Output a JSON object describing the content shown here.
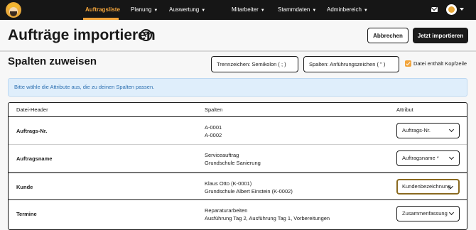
{
  "nav": {
    "items": [
      {
        "label": "Auftragsliste",
        "caret": ""
      },
      {
        "label": "Planung",
        "caret": "▼"
      },
      {
        "label": "Auswertung",
        "caret": "▼"
      },
      {
        "label": "Mitarbeiter",
        "caret": "▼"
      },
      {
        "label": "Stammdaten",
        "caret": "▼"
      },
      {
        "label": "Adminbereich",
        "caret": "▼"
      }
    ],
    "active_color": "#f2a43b"
  },
  "header": {
    "title": "Aufträge importieren",
    "help": "?",
    "cancel_label": "Abbrechen",
    "import_label": "Jetzt importieren"
  },
  "section": {
    "title": "Spalten zuweisen",
    "separator_select": "Trennzeichen: Semikolon ( ; )",
    "quote_select": "Spalten: Anführungszeichen ( \" )",
    "header_checkbox_label": "Datei enthält Kopfzeile",
    "header_checkbox_checked": true
  },
  "info": {
    "text": "Bitte wähle die Attribute aus, die zu deinen Spalten passen."
  },
  "table": {
    "columns": [
      "Datei-Header",
      "Spalten",
      "Attribut"
    ],
    "rows": [
      {
        "header": "Auftrags-Nr.",
        "line1": "A-0001",
        "line2": "A-0002",
        "attribute": "Auftrags-Nr."
      },
      {
        "header": "Auftragsname",
        "line1": "Serviceauftrag",
        "line2": "Grundschule Sanierung",
        "attribute": "Auftragsname *"
      },
      {
        "header": "Kunde",
        "line1": "Klaus Otto (K-0001)",
        "line2": "Grundschule Albert Einstein (K-0002)",
        "attribute": "Kundenbezeichnung"
      },
      {
        "header": "Termine",
        "line1": "Reparaturarbeiten",
        "line2": "Ausführung Tag 2, Ausführung Tag 1, Vorbereitungen",
        "attribute": "Zusammenfassung"
      }
    ]
  }
}
